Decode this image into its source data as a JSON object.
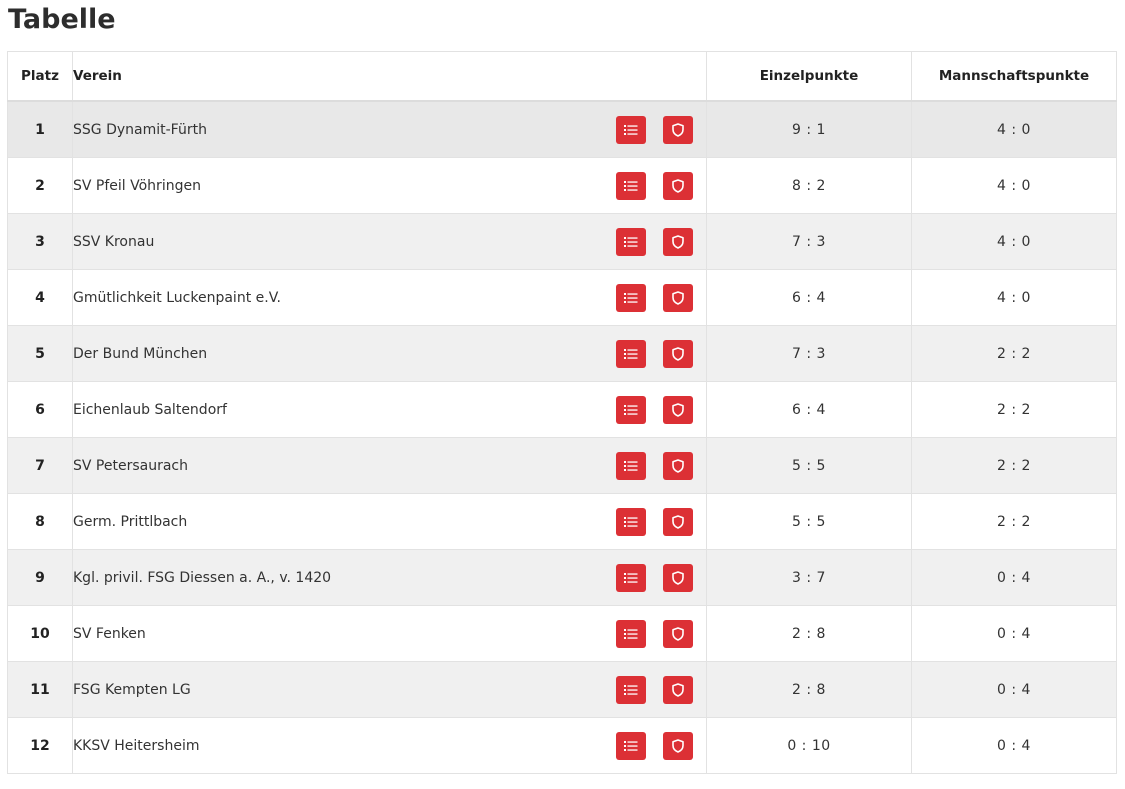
{
  "page": {
    "title": "Tabelle"
  },
  "colors": {
    "accent": "#dc3035",
    "stripe": "#f0f0f0",
    "border": "#e2e2e2"
  },
  "table": {
    "headers": {
      "rank": "Platz",
      "club": "Verein",
      "single_points": "Einzelpunkte",
      "team_points": "Mannschaftspunkte"
    },
    "row_action_icons": [
      "list-icon",
      "shield-icon"
    ],
    "rows": [
      {
        "rank": "1",
        "club": "SSG Dynamit-Fürth",
        "single_points": "9 : 1",
        "team_points": "4 : 0"
      },
      {
        "rank": "2",
        "club": "SV Pfeil Vöhringen",
        "single_points": "8 : 2",
        "team_points": "4 : 0"
      },
      {
        "rank": "3",
        "club": "SSV Kronau",
        "single_points": "7 : 3",
        "team_points": "4 : 0"
      },
      {
        "rank": "4",
        "club": "Gmütlichkeit Luckenpaint e.V.",
        "single_points": "6 : 4",
        "team_points": "4 : 0"
      },
      {
        "rank": "5",
        "club": "Der Bund München",
        "single_points": "7 : 3",
        "team_points": "2 : 2"
      },
      {
        "rank": "6",
        "club": "Eichenlaub Saltendorf",
        "single_points": "6 : 4",
        "team_points": "2 : 2"
      },
      {
        "rank": "7",
        "club": "SV Petersaurach",
        "single_points": "5 : 5",
        "team_points": "2 : 2"
      },
      {
        "rank": "8",
        "club": "Germ. Prittlbach",
        "single_points": "5 : 5",
        "team_points": "2 : 2"
      },
      {
        "rank": "9",
        "club": "Kgl. privil. FSG Diessen a. A., v. 1420",
        "single_points": "3 : 7",
        "team_points": "0 : 4"
      },
      {
        "rank": "10",
        "club": "SV Fenken",
        "single_points": "2 : 8",
        "team_points": "0 : 4"
      },
      {
        "rank": "11",
        "club": "FSG Kempten LG",
        "single_points": "2 : 8",
        "team_points": "0 : 4"
      },
      {
        "rank": "12",
        "club": "KKSV Heitersheim",
        "single_points": "0 : 10",
        "team_points": "0 : 4"
      }
    ]
  }
}
